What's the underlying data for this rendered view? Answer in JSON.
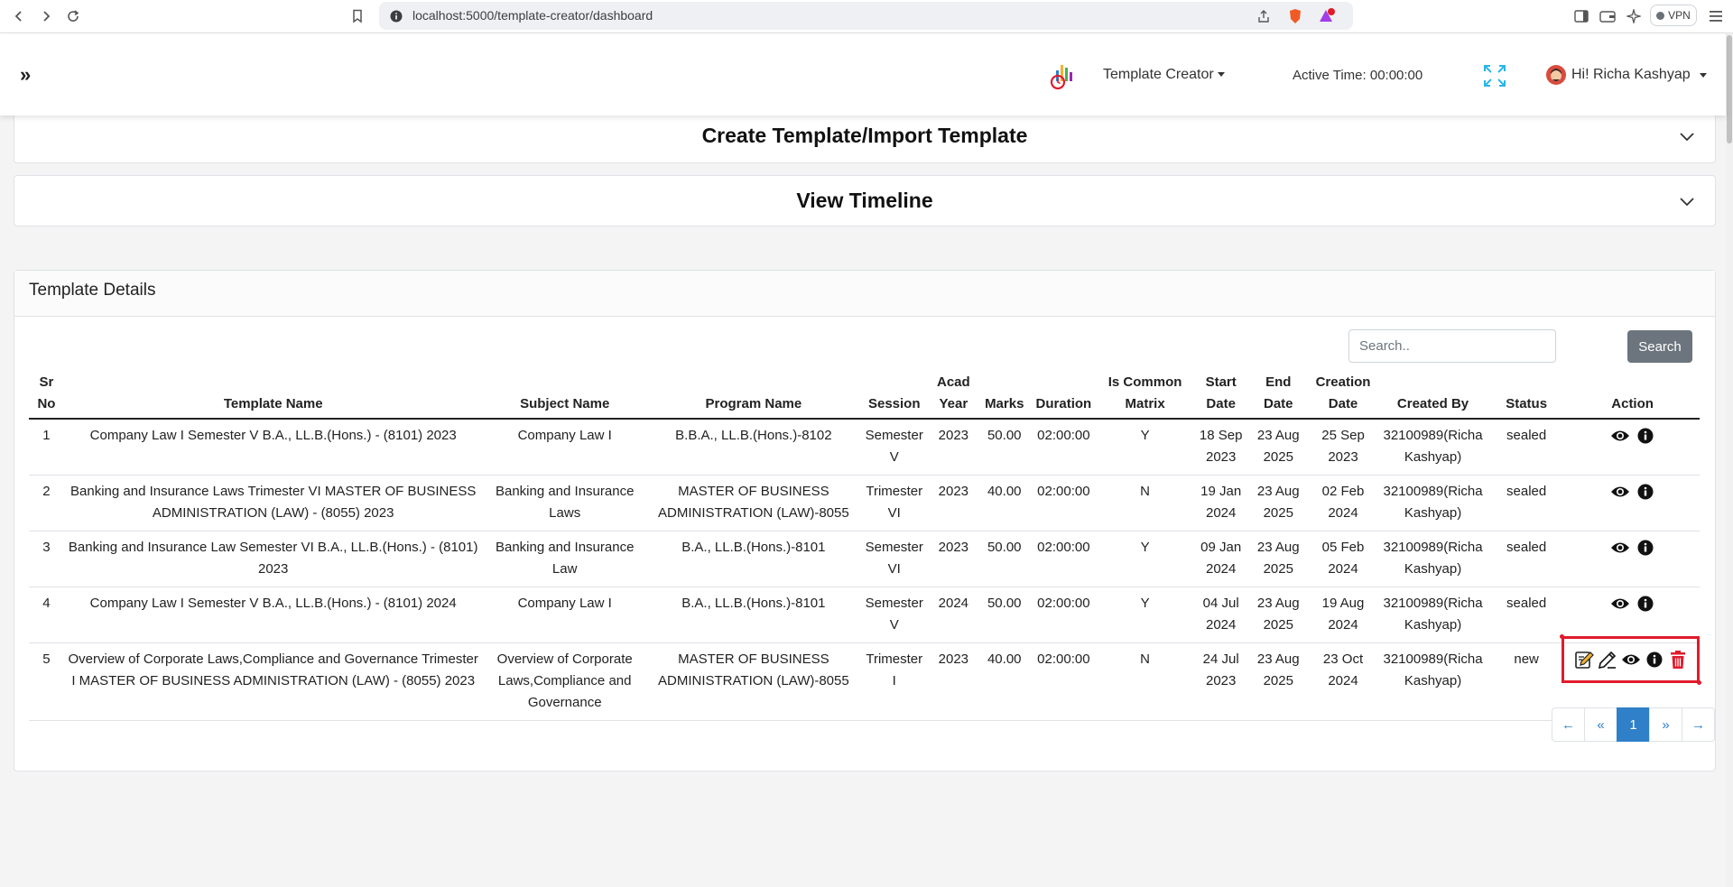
{
  "browser": {
    "url": "localhost:5000/template-creator/dashboard",
    "vpn_label": "VPN",
    "notification_count": "1"
  },
  "header": {
    "menu_label": "Template Creator",
    "active_time": "Active Time: 00:00:00",
    "user_greeting": "Hi! Richa Kashyap"
  },
  "accordions": {
    "create": "Create Template/Import Template",
    "timeline": "View Timeline"
  },
  "card": {
    "title": "Template Details",
    "search_placeholder": "Search..",
    "search_button": "Search"
  },
  "table": {
    "headers": {
      "sr_no": [
        "Sr",
        "No"
      ],
      "template_name": "Template Name",
      "subject_name": "Subject Name",
      "program_name": "Program Name",
      "session": "Session",
      "acad_year": [
        "Acad",
        "Year"
      ],
      "marks": "Marks",
      "duration": "Duration",
      "is_common_matrix": [
        "Is Common",
        "Matrix"
      ],
      "start_date": [
        "Start",
        "Date"
      ],
      "end_date": [
        "End",
        "Date"
      ],
      "creation_date": [
        "Creation",
        "Date"
      ],
      "created_by": "Created By",
      "status": "Status",
      "action": "Action"
    },
    "rows": [
      {
        "sr": "1",
        "template_name": "Company Law I Semester V B.A., LL.B.(Hons.) - (8101) 2023",
        "subject_name": "Company Law I",
        "program_name": "B.B.A., LL.B.(Hons.)-8102",
        "session": "Semester V",
        "acad_year": "2023",
        "marks": "50.00",
        "duration": "02:00:00",
        "is_common": "Y",
        "start_date": "18 Sep 2023",
        "end_date": "23 Aug 2025",
        "creation_date": "25 Sep 2023",
        "created_by": "32100989(Richa Kashyap)",
        "status": "sealed"
      },
      {
        "sr": "2",
        "template_name": "Banking and Insurance Laws Trimester VI MASTER OF BUSINESS ADMINISTRATION (LAW) - (8055) 2023",
        "subject_name": "Banking and Insurance Laws",
        "program_name": "MASTER OF BUSINESS ADMINISTRATION (LAW)-8055",
        "session": "Trimester VI",
        "acad_year": "2023",
        "marks": "40.00",
        "duration": "02:00:00",
        "is_common": "N",
        "start_date": "19 Jan 2024",
        "end_date": "23 Aug 2025",
        "creation_date": "02 Feb 2024",
        "created_by": "32100989(Richa Kashyap)",
        "status": "sealed"
      },
      {
        "sr": "3",
        "template_name": "Banking and Insurance Law Semester VI B.A., LL.B.(Hons.) - (8101) 2023",
        "subject_name": "Banking and Insurance Law",
        "program_name": "B.A., LL.B.(Hons.)-8101",
        "session": "Semester VI",
        "acad_year": "2023",
        "marks": "50.00",
        "duration": "02:00:00",
        "is_common": "Y",
        "start_date": "09 Jan 2024",
        "end_date": "23 Aug 2025",
        "creation_date": "05 Feb 2024",
        "created_by": "32100989(Richa Kashyap)",
        "status": "sealed"
      },
      {
        "sr": "4",
        "template_name": "Company Law I Semester V B.A., LL.B.(Hons.) - (8101) 2024",
        "subject_name": "Company Law I",
        "program_name": "B.A., LL.B.(Hons.)-8101",
        "session": "Semester V",
        "acad_year": "2024",
        "marks": "50.00",
        "duration": "02:00:00",
        "is_common": "Y",
        "start_date": "04 Jul 2024",
        "end_date": "23 Aug 2025",
        "creation_date": "19 Aug 2024",
        "created_by": "32100989(Richa Kashyap)",
        "status": "sealed"
      },
      {
        "sr": "5",
        "template_name": "Overview of Corporate Laws,Compliance and Governance Trimester I MASTER OF BUSINESS ADMINISTRATION (LAW) - (8055) 2023",
        "subject_name": "Overview of Corporate Laws,Compliance and Governance",
        "program_name": "MASTER OF BUSINESS ADMINISTRATION (LAW)-8055",
        "session": "Trimester I",
        "acad_year": "2023",
        "marks": "40.00",
        "duration": "02:00:00",
        "is_common": "N",
        "start_date": "24 Jul 2023",
        "end_date": "23 Aug 2025",
        "creation_date": "23 Oct 2024",
        "created_by": "32100989(Richa Kashyap)",
        "status": "new"
      }
    ]
  },
  "pagination": {
    "first": "←",
    "prev": "«",
    "current": "1",
    "next": "»",
    "last": "→"
  },
  "colors": {
    "accent": "#2f80c8",
    "highlight_box": "#e01b2c",
    "delete": "#e01b2c",
    "secondary_button": "#6c757d"
  },
  "icons": {
    "row_sealed": [
      "eye-icon",
      "info-icon"
    ],
    "row_new": [
      "edit-matrix-icon",
      "pencil-icon",
      "eye-icon",
      "info-icon",
      "trash-icon"
    ]
  }
}
